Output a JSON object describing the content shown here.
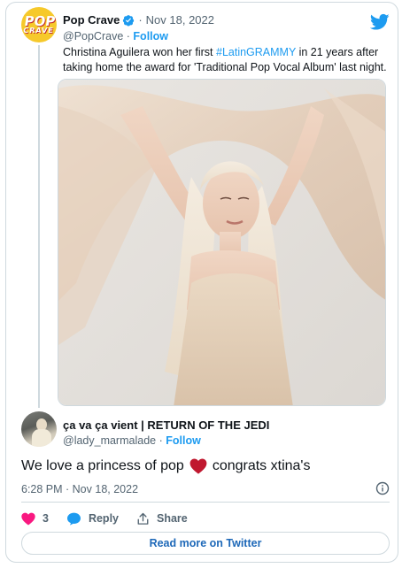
{
  "quoted_tweet": {
    "author_name": "Pop Crave",
    "handle": "@PopCrave",
    "date": "Nov 18, 2022",
    "follow_label": "Follow",
    "separator": "·",
    "avatar_text_top": "POP",
    "avatar_text_bottom": "CRAVE",
    "text_before": "Christina Aguilera won her first ",
    "hashtag": "#LatinGRAMMY",
    "text_after": " in 21 years after taking home the award for 'Traditional Pop Vocal Album' last night."
  },
  "tweet": {
    "author_name": "ça va ça vient | RETURN OF THE JEDI",
    "handle": "@lady_marmalade",
    "follow_label": "Follow",
    "separator": "·",
    "text_before": "We love a princess of pop",
    "text_after": "congrats xtina's",
    "timestamp": "6:28 PM · Nov 18, 2022"
  },
  "actions": {
    "like_count": "3",
    "reply_label": "Reply",
    "share_label": "Share"
  },
  "read_more_label": "Read more on Twitter",
  "icons": {
    "brand": "twitter-bird-icon",
    "verified": "verified-badge-icon",
    "info": "info-icon",
    "like": "heart-icon",
    "reply": "reply-bubble-icon",
    "share": "share-icon",
    "emoji": "red-heart-emoji"
  },
  "colors": {
    "twitter_blue": "#1d9bf0",
    "link_blue": "#1d68b8",
    "like_pink": "#f91880",
    "emoji_red": "#c0182f",
    "secondary_text": "#536471",
    "border": "#cfd9de"
  }
}
